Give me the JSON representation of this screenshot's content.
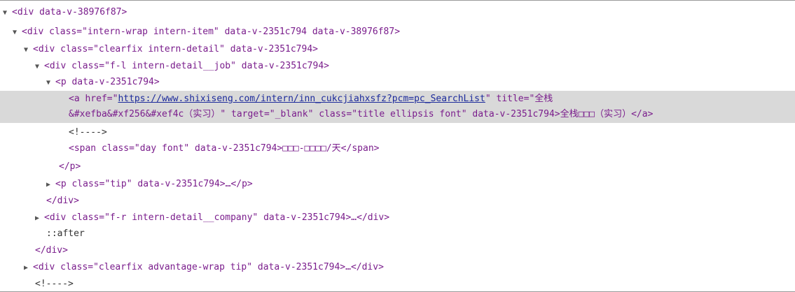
{
  "lines": [
    {
      "t": "▼",
      "text": "<div data-v-38976f87>"
    },
    {
      "t": "▼",
      "text": "<div class=\"intern-wrap intern-item\" data-v-2351c794 data-v-38976f87>"
    },
    {
      "t": "▼",
      "text": "<div class=\"clearfix intern-detail\" data-v-2351c794>"
    },
    {
      "t": "▼",
      "text": "<div class=\"f-l intern-detail__job\" data-v-2351c794>"
    },
    {
      "t": "▼",
      "text": "<p data-v-2351c794>"
    },
    {
      "t": "",
      "a_open": "<a href=\"",
      "url": "https://www.shixiseng.com/intern/inn_cukcjiahxsfz?pcm=pc_SearchList",
      "a_rest": "\" title=\"全栈"
    },
    {
      "t": "",
      "text": "&#xefba&#xf256&#xef4c（实习）\" target=\"_blank\" class=\"title ellipsis font\" data-v-2351c794>全栈□□□（实习）</a>"
    },
    {
      "t": "",
      "text": "<!---->"
    },
    {
      "t": "",
      "text": "<span class=\"day font\" data-v-2351c794>□□□-□□□□/天</span>"
    },
    {
      "t": "",
      "text": "</p>"
    },
    {
      "t": "▶",
      "text": "<p class=\"tip\" data-v-2351c794>…</p>"
    },
    {
      "t": "",
      "text": "</div>"
    },
    {
      "t": "▶",
      "text": "<div class=\"f-r intern-detail__company\" data-v-2351c794>…</div>"
    },
    {
      "t": "",
      "text": "::after"
    },
    {
      "t": "",
      "text": "</div>"
    },
    {
      "t": "▶",
      "text": "<div class=\"clearfix advantage-wrap tip\" data-v-2351c794>…</div>"
    },
    {
      "t": "",
      "text": "<!---->"
    }
  ]
}
